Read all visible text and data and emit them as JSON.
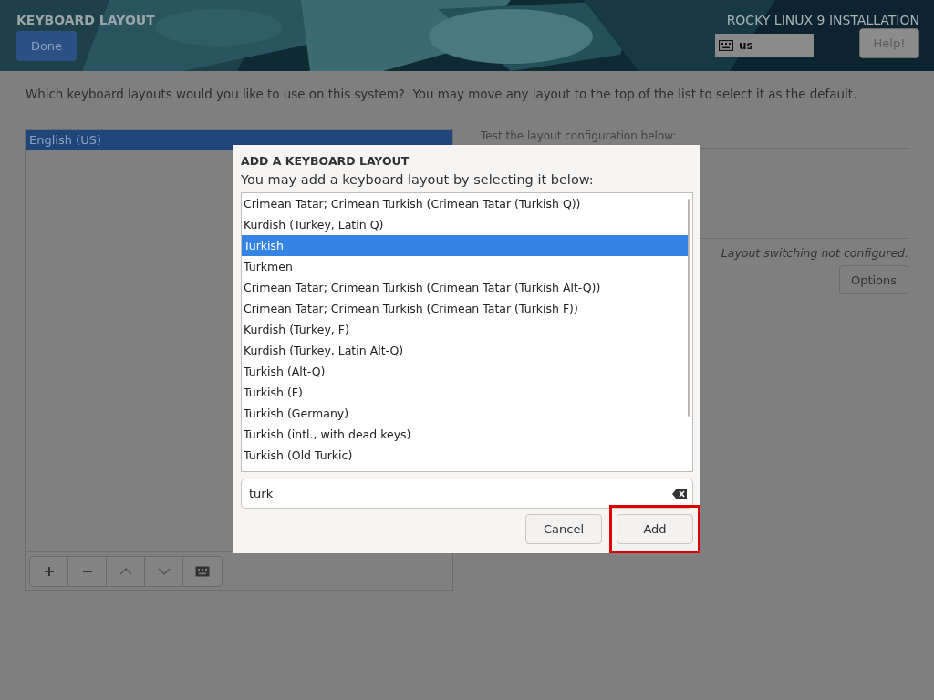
{
  "header": {
    "title": "KEYBOARD LAYOUT",
    "done_button": "Done",
    "product": "ROCKY LINUX 9 INSTALLATION",
    "layout_indicator": "us",
    "help_button": "Help!"
  },
  "instruction": "Which keyboard layouts would you like to use on this system?  You may move any layout to the top of the list to select it as the default.",
  "layouts": [
    {
      "name": "English (US)",
      "selected": true
    }
  ],
  "test_area": {
    "label": "Test the layout configuration below:",
    "status": "Layout switching not configured.",
    "options_button": "Options"
  },
  "dialog": {
    "title": "ADD A KEYBOARD LAYOUT",
    "subtitle": "You may add a keyboard layout by selecting it below:",
    "options": [
      {
        "name": "Crimean Tatar; Crimean Turkish (Crimean Tatar (Turkish Q))",
        "selected": false
      },
      {
        "name": "Kurdish (Turkey, Latin Q)",
        "selected": false
      },
      {
        "name": "Turkish",
        "selected": true
      },
      {
        "name": "Turkmen",
        "selected": false
      },
      {
        "name": "Crimean Tatar; Crimean Turkish (Crimean Tatar (Turkish Alt-Q))",
        "selected": false
      },
      {
        "name": "Crimean Tatar; Crimean Turkish (Crimean Tatar (Turkish F))",
        "selected": false
      },
      {
        "name": "Kurdish (Turkey, F)",
        "selected": false
      },
      {
        "name": "Kurdish (Turkey, Latin Alt-Q)",
        "selected": false
      },
      {
        "name": "Turkish (Alt-Q)",
        "selected": false
      },
      {
        "name": "Turkish (F)",
        "selected": false
      },
      {
        "name": "Turkish (Germany)",
        "selected": false
      },
      {
        "name": "Turkish (intl., with dead keys)",
        "selected": false
      },
      {
        "name": "Turkish (Old Turkic)",
        "selected": false
      }
    ],
    "search": {
      "value": "turk"
    },
    "buttons": [
      {
        "label": "Cancel",
        "highlighted": false
      },
      {
        "label": "Add",
        "highlighted": true
      }
    ]
  }
}
